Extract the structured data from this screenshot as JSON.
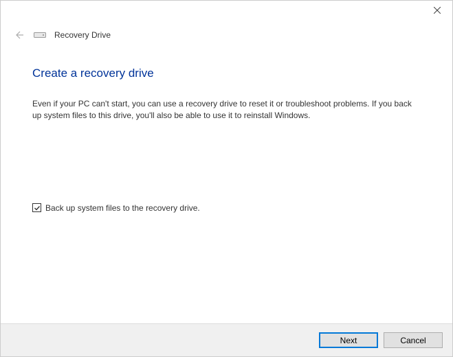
{
  "window": {
    "title": "Recovery Drive"
  },
  "main": {
    "heading": "Create a recovery drive",
    "description": "Even if your PC can't start, you can use a recovery drive to reset it or troubleshoot problems. If you back up system files to this drive, you'll also be able to use it to reinstall Windows."
  },
  "checkbox": {
    "label": "Back up system files to the recovery drive.",
    "checked": true
  },
  "footer": {
    "next": "Next",
    "cancel": "Cancel"
  }
}
